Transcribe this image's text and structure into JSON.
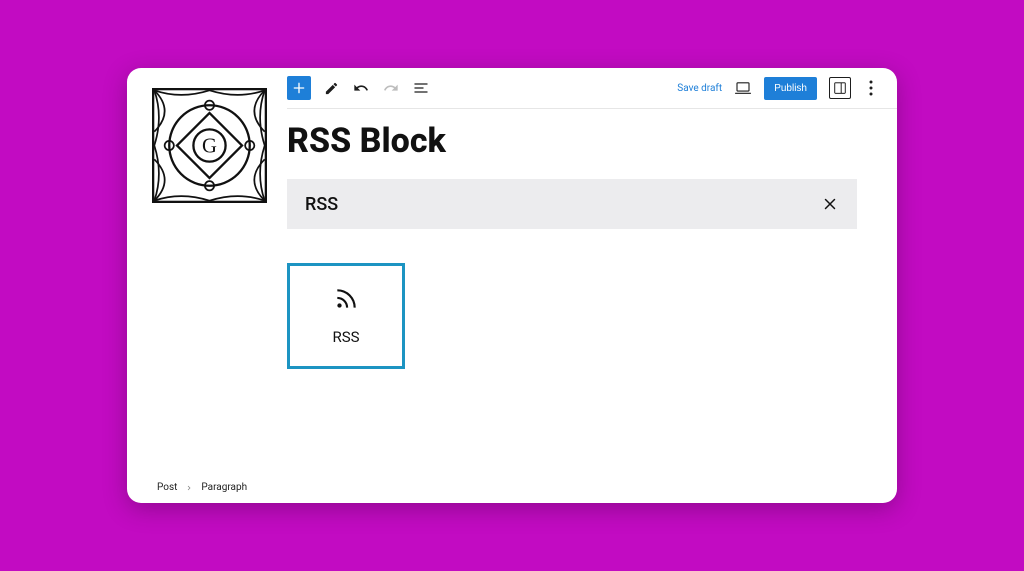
{
  "logo_letter": "G",
  "toolbar": {
    "save_draft_label": "Save draft",
    "publish_label": "Publish"
  },
  "title": "RSS Block",
  "search": {
    "input_value": "RSS"
  },
  "result": {
    "block_label": "RSS"
  },
  "breadcrumb": {
    "level1": "Post",
    "level2": "Paragraph"
  },
  "colors": {
    "background": "#c20bc2",
    "primary": "#1e7fd8",
    "selection": "#1c94c2"
  }
}
